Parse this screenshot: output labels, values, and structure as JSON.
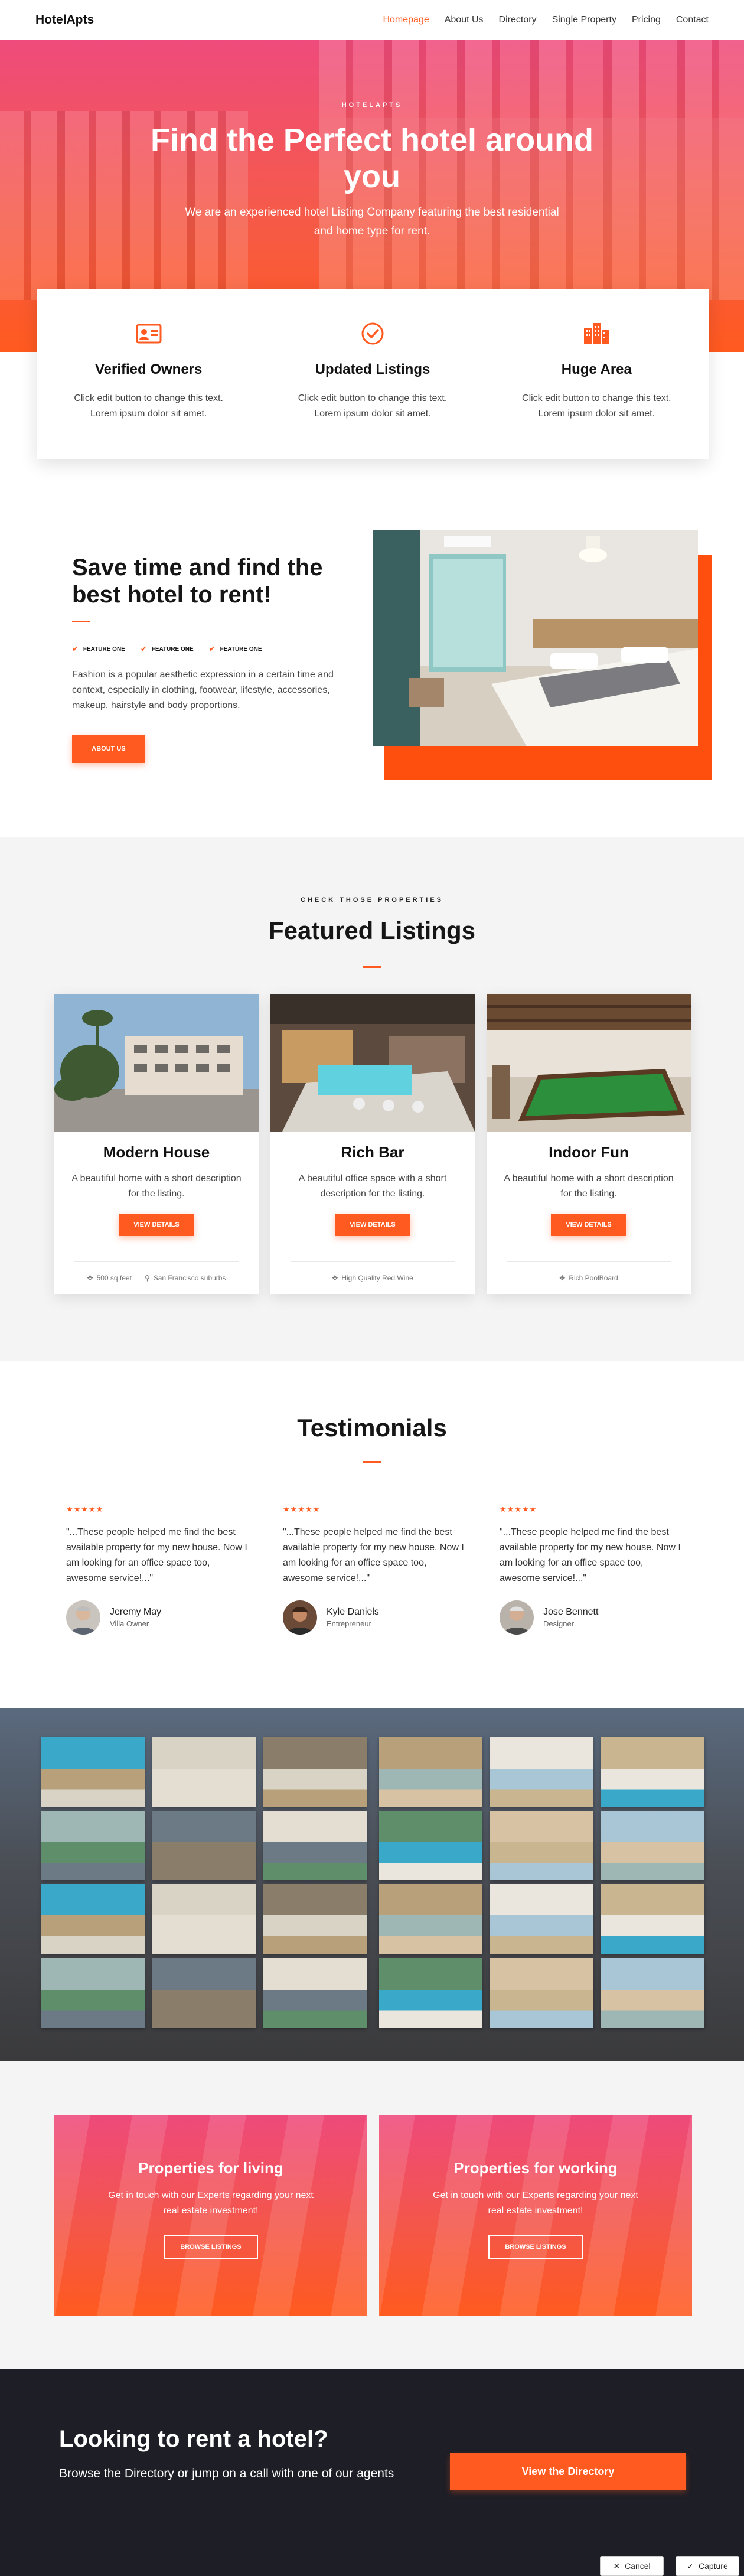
{
  "brand": "HotelApts",
  "nav": [
    "Homepage",
    "About Us",
    "Directory",
    "Single Property",
    "Pricing",
    "Contact"
  ],
  "hero": {
    "eyebrow": "HOTELAPTS",
    "title": "Find the Perfect hotel around you",
    "subtitle": "We are an experienced hotel Listing Company featuring the best residential and home type for rent."
  },
  "features": [
    {
      "icon": "id-card-icon",
      "title": "Verified Owners",
      "text": "Click edit button to change this text. Lorem ipsum dolor sit amet."
    },
    {
      "icon": "check-circle-icon",
      "title": "Updated Listings",
      "text": "Click edit button to change this text. Lorem ipsum dolor sit amet."
    },
    {
      "icon": "buildings-icon",
      "title": "Huge Area",
      "text": "Click edit button to change this text. Lorem ipsum dolor sit amet."
    }
  ],
  "save": {
    "title": "Save time and find the best hotel to rent!",
    "checks": [
      "FEATURE ONE",
      "FEATURE ONE",
      "FEATURE ONE"
    ],
    "text": "Fashion is a popular aesthetic expression in a certain time and context, especially in clothing, footwear, lifestyle, accessories, makeup, hairstyle and body proportions.",
    "button": "ABOUT US"
  },
  "listings": {
    "eyebrow": "CHECK THOSE PROPERTIES",
    "title": "Featured Listings",
    "cards": [
      {
        "title": "Modern House",
        "text": "A beautiful home with a short description for the listing.",
        "button": "VIEW DETAILS",
        "meta": [
          "500 sq feet",
          "San Francisco suburbs"
        ]
      },
      {
        "title": "Rich Bar",
        "text": "A beautiful office space with a short description for the listing.",
        "button": "VIEW DETAILS",
        "meta": [
          "High Quality Red Wine"
        ]
      },
      {
        "title": "Indoor Fun",
        "text": "A beautiful home with a short description for the listing.",
        "button": "VIEW DETAILS",
        "meta": [
          "Rich PoolBoard"
        ]
      }
    ]
  },
  "testimonials": {
    "title": "Testimonials",
    "items": [
      {
        "stars": "★★★★★",
        "quote": "\"...These people helped me find the best available property for my new house. Now I am looking for an office space too, awesome service!...\"",
        "name": "Jeremy May",
        "role": "Villa Owner"
      },
      {
        "stars": "★★★★★",
        "quote": "\"...These people helped me find the best available property for my new house. Now I am looking for an office space too, awesome service!...\"",
        "name": "Kyle Daniels",
        "role": "Entrepreneur"
      },
      {
        "stars": "★★★★★",
        "quote": "\"...These people helped me find the best available property for my new house. Now I am looking for an office space too, awesome service!...\"",
        "name": "Jose Bennett",
        "role": "Designer"
      }
    ]
  },
  "boxes": [
    {
      "title": "Properties for living",
      "text": "Get in touch with our Experts regarding your next real estate investment!",
      "button": "BROWSE LISTINGS"
    },
    {
      "title": "Properties for working",
      "text": "Get in touch with our Experts regarding your next real estate investment!",
      "button": "BROWSE LISTINGS"
    }
  ],
  "footer": {
    "title": "Looking to rent a hotel?",
    "text": "Browse the Directory or jump on a call with one of our agents",
    "button": "View the Directory"
  },
  "toolbar": {
    "cancel": "Cancel",
    "capture": "Capture"
  },
  "colors": {
    "accent": "#ff5a1f",
    "pink": "#ee4a7b",
    "footer_bg": "#1d1e26"
  }
}
